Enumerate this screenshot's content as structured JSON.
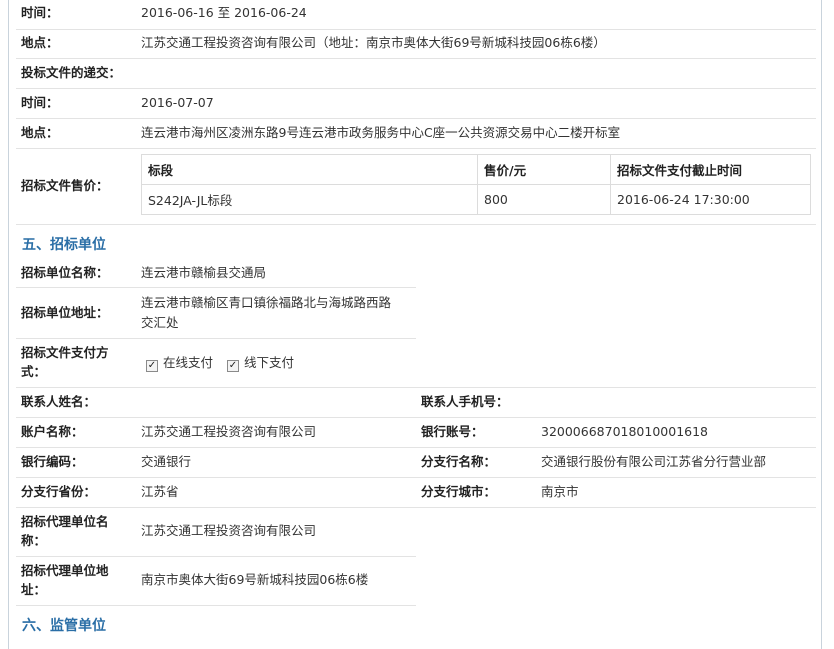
{
  "sale_period": {
    "label": "时间：",
    "value": "2016-06-16 至 2016-06-24"
  },
  "sale_place": {
    "label": "地点：",
    "value": "江苏交通工程投资咨询有限公司（地址：南京市奥体大街69号新城科技园06栋6楼）"
  },
  "submission": {
    "label": "投标文件的递交："
  },
  "submit_time": {
    "label": "时间：",
    "value": "2016-07-07"
  },
  "submit_place": {
    "label": "地点：",
    "value": "连云港市海州区凌洲东路9号连云港市政务服务中心C座一公共资源交易中心二楼开标室"
  },
  "price": {
    "label": "招标文件售价：",
    "headers": [
      "标段",
      "售价/元",
      "招标文件支付截止时间"
    ],
    "row": [
      "S242JA-JL标段",
      "800",
      "2016-06-24 17:30:00"
    ]
  },
  "section5": "五、招标单位",
  "tenderer_name": {
    "label": "招标单位名称：",
    "value": "连云港市赣榆县交通局"
  },
  "tenderer_addr": {
    "label": "招标单位地址：",
    "line1": "连云港市赣榆区青口镇徐福路北与海城路西路",
    "line2": "交汇处"
  },
  "pay_method": {
    "label1": "招标文件支付方",
    "label2": "式：",
    "opt1": "在线支付",
    "opt2": "线下支付",
    "check": "✓"
  },
  "contact": {
    "name_label": "联系人姓名：",
    "phone_label": "联系人手机号："
  },
  "account": {
    "label": "账户名称：",
    "value": "江苏交通工程投资咨询有限公司",
    "bank_no_label": "银行账号：",
    "bank_no": "320006687018010001618"
  },
  "bank": {
    "label": "银行编码：",
    "value": "交通银行",
    "branch_label": "分支行名称：",
    "branch": "交通银行股份有限公司江苏省分行营业部"
  },
  "province": {
    "label": "分支行省份：",
    "value": "江苏省",
    "city_label": "分支行城市：",
    "city": "南京市"
  },
  "agent_name": {
    "label1": "招标代理单位名",
    "label2": "称：",
    "value": "江苏交通工程投资咨询有限公司"
  },
  "agent_addr": {
    "label1": "招标代理单位地",
    "label2": "址：",
    "value": "南京市奥体大街69号新城科技园06栋6楼"
  },
  "section6": "六、监管单位"
}
